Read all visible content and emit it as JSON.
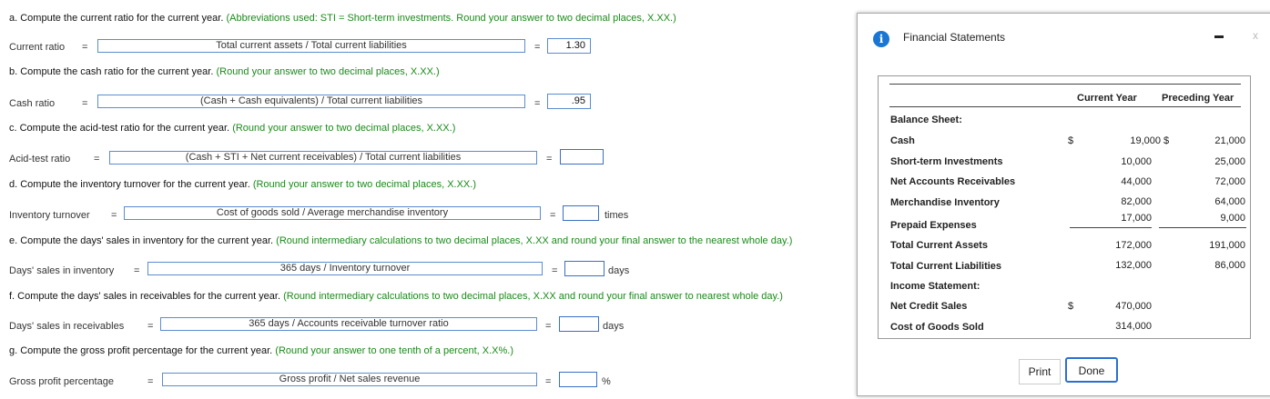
{
  "questions": {
    "a": {
      "prompt": "a. Compute the current ratio for the current year.",
      "hint": "(Abbreviations used: STI = Short-term investments. Round your answer to two decimal places, X.XX.)",
      "label": "Current ratio",
      "eq": "=",
      "formula": "Total current assets / Total current liabilities",
      "eq2": "=",
      "answer": "1.30",
      "unit": ""
    },
    "b": {
      "prompt": "b. Compute the cash ratio for the current year.",
      "hint": "(Round your answer to two decimal places, X.XX.)",
      "label": "Cash ratio",
      "eq": "=",
      "formula": "(Cash + Cash equivalents) / Total current liabilities",
      "eq2": "=",
      "answer": ".95",
      "unit": ""
    },
    "c": {
      "prompt": "c. Compute the acid-test ratio for the current year.",
      "hint": "(Round your answer to two decimal places, X.XX.)",
      "label": "Acid-test ratio",
      "eq": "=",
      "formula": "(Cash + STI + Net current receivables) / Total current liabilities",
      "eq2": "=",
      "answer": "",
      "unit": ""
    },
    "d": {
      "prompt": "d. Compute the inventory turnover for the current year.",
      "hint": "(Round your answer to two decimal places, X.XX.)",
      "label": "Inventory turnover",
      "eq": "=",
      "formula": "Cost of goods sold / Average merchandise inventory",
      "eq2": "=",
      "answer": "",
      "unit": "times"
    },
    "e": {
      "prompt": "e. Compute the days' sales in inventory for the current year.",
      "hint": "(Round intermediary calculations to two decimal places, X.XX and round your final answer to the nearest whole day.)",
      "label": "Days' sales in inventory",
      "eq": "=",
      "formula": "365 days / Inventory turnover",
      "eq2": "=",
      "answer": "",
      "unit": "days"
    },
    "f": {
      "prompt": "f. Compute the days' sales in receivables for the current year.",
      "hint": "(Round intermediary calculations to two decimal places, X.XX and round your final answer to nearest whole day.)",
      "label": "Days' sales in receivables",
      "eq": "=",
      "formula": "365 days / Accounts receivable turnover ratio",
      "eq2": "=",
      "answer": "",
      "unit": "days"
    },
    "g": {
      "prompt": "g. Compute the gross profit percentage for the current year.",
      "hint": "(Round your answer to one tenth of a percent, X.X%.)",
      "label": "Gross profit percentage",
      "eq": "=",
      "formula": "Gross profit / Net sales revenue",
      "eq2": "=",
      "answer": "",
      "unit": "%"
    }
  },
  "dialog": {
    "title": "Financial Statements",
    "info_icon": "i",
    "close_icon": "x",
    "col_current": "Current Year",
    "col_preceding": "Preceding Year",
    "balance_sheet": "Balance Sheet:",
    "income_statement": "Income Statement:",
    "rows": {
      "cash": {
        "label": "Cash",
        "cur_sym": "$",
        "cur": "19,000",
        "pre_sym": "$",
        "pre": "21,000"
      },
      "sti": {
        "label": "Short-term Investments",
        "cur": "10,000",
        "pre": "25,000"
      },
      "ar": {
        "label": "Net Accounts Receivables",
        "cur": "44,000",
        "pre": "72,000"
      },
      "inv": {
        "label": "Merchandise Inventory",
        "cur": "82,000",
        "pre": "64,000"
      },
      "prepaid": {
        "label": "Prepaid Expenses",
        "cur": "17,000",
        "pre": "9,000"
      },
      "tca": {
        "label": "Total Current Assets",
        "cur": "172,000",
        "pre": "191,000"
      },
      "tcl": {
        "label": "Total Current Liabilities",
        "cur": "132,000",
        "pre": "86,000"
      },
      "ncs": {
        "label": "Net Credit Sales",
        "cur_sym": "$",
        "cur": "470,000"
      },
      "cogs": {
        "label": "Cost of Goods Sold",
        "cur": "314,000"
      }
    },
    "print_label": "Print",
    "done_label": "Done"
  }
}
